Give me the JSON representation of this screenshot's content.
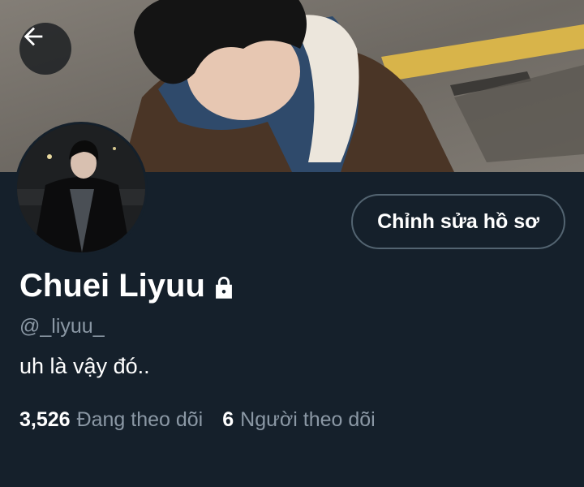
{
  "header": {
    "back_icon": "arrow-left-icon"
  },
  "profile": {
    "display_name": "Chuei Liyuu",
    "protected_icon": "lock-icon",
    "handle": "@_liyuu_",
    "bio": "uh là vậy đó..",
    "edit_button_label": "Chỉnh sửa hồ sơ"
  },
  "stats": {
    "following_count": "3,526",
    "following_label": "Đang theo dõi",
    "followers_count": "6",
    "followers_label": "Người theo dõi"
  },
  "colors": {
    "background": "#15202b",
    "secondary_text": "#8b98a5",
    "button_border": "#536471"
  }
}
